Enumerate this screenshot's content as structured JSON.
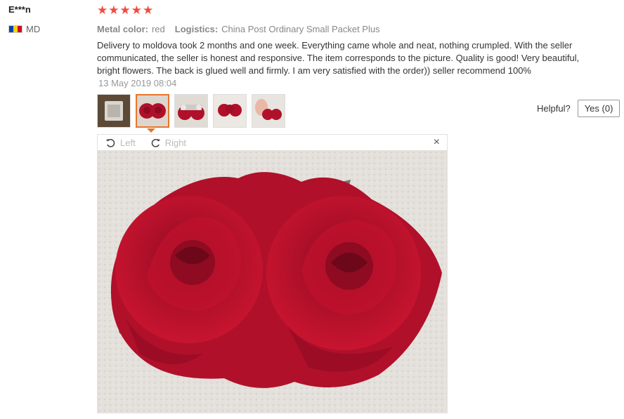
{
  "user": {
    "name": "E***n",
    "country": "MD"
  },
  "review": {
    "stars": [
      "★",
      "★",
      "★",
      "★",
      "★"
    ],
    "metal_label": "Metal color:",
    "metal_value": "red",
    "logistics_label": "Logistics:",
    "logistics_value": "China Post Ordinary Small Packet Plus",
    "text": "Delivery to moldova took 2 months and one week. Everything came whole and neat, nothing crumpled. With the seller communicated, the seller is honest and responsive. The item corresponds to the picture. Quality is good! Very beautiful, bright flowers. The back is glued well and firmly. I am very satisfied with the order)) seller recommend 100%",
    "date": "13 May 2019 08:04"
  },
  "helpful": {
    "label": "Helpful?",
    "yes": "Yes (0)"
  },
  "viewer": {
    "left": "Left",
    "right": "Right",
    "close": "×"
  },
  "colors": {
    "star": "#ef4d41",
    "active_border": "#e8752b",
    "rose": "#b0102a"
  },
  "icons": [
    "rotate-left-icon",
    "rotate-right-icon",
    "close-icon",
    "star-icon",
    "flag-icon"
  ]
}
